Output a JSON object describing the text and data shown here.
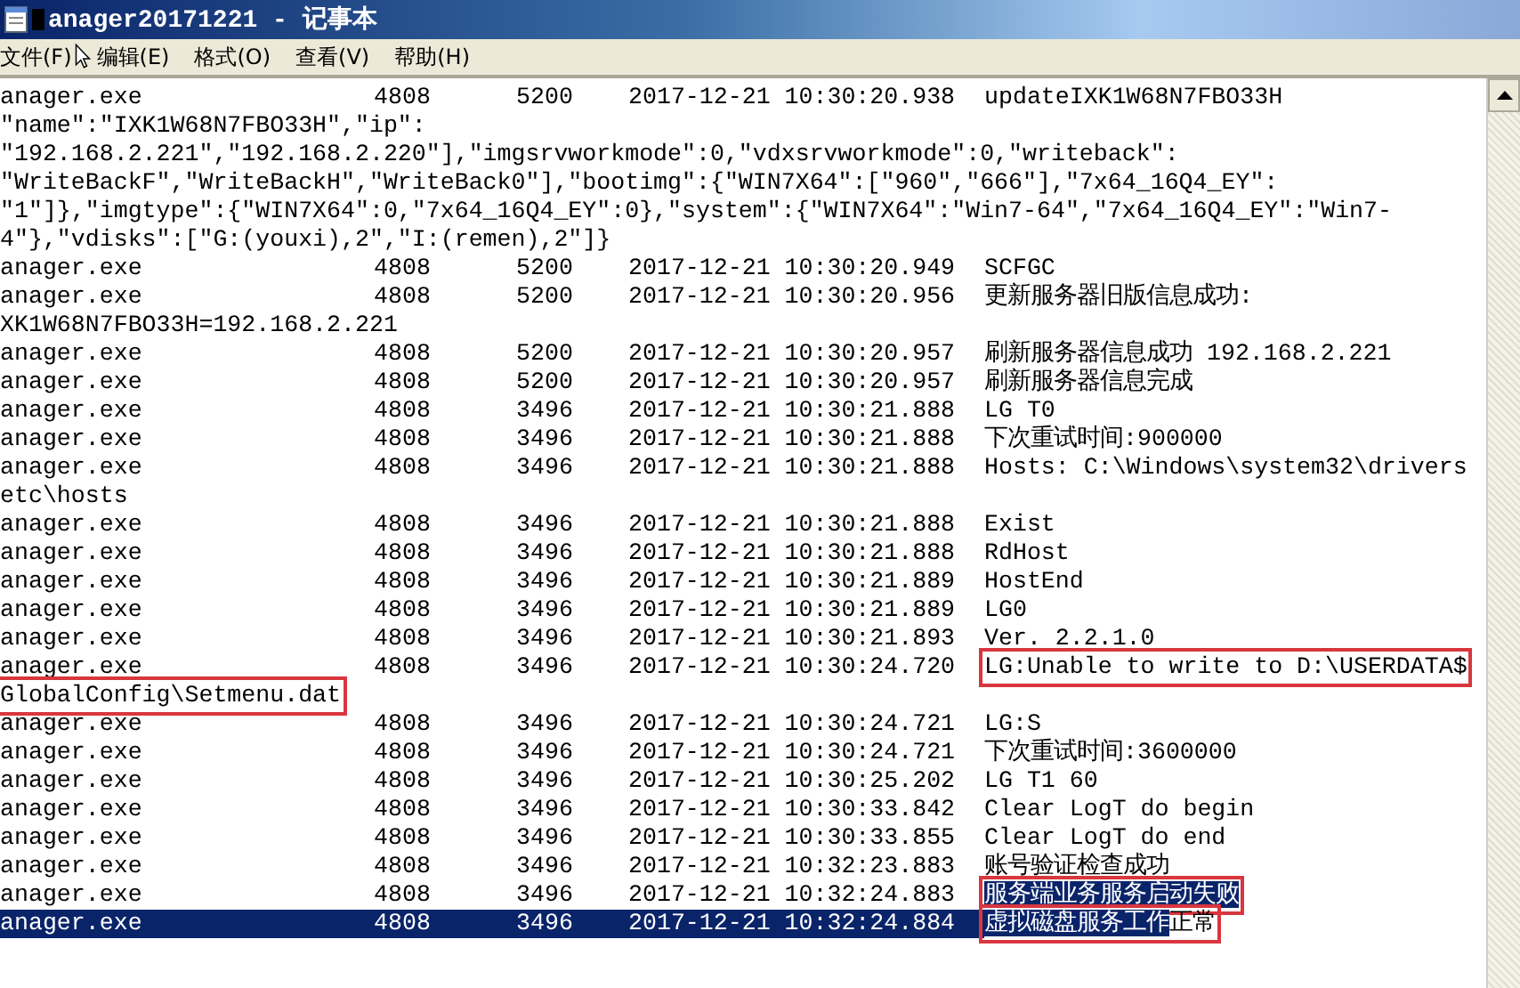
{
  "window": {
    "title": "anager20171221 - 记事本"
  },
  "menu": [
    {
      "label": "文件(F)"
    },
    {
      "label": "编辑(E)"
    },
    {
      "label": "格式(O)"
    },
    {
      "label": "查看(V)"
    },
    {
      "label": "帮助(H)"
    }
  ],
  "lines": [
    {
      "kind": "row",
      "selected": false,
      "cells": [
        "anager.exe",
        "4808",
        "5200",
        "2017-12-21 10:30:20.938"
      ],
      "message": [
        {
          "text": "updateIXK1W68N7FBO33H",
          "selected": false
        }
      ]
    },
    {
      "kind": "wrap",
      "text": "\"name\":\"IXK1W68N7FBO33H\",\"ip\":"
    },
    {
      "kind": "wrap",
      "text": "\"192.168.2.221\",\"192.168.2.220\"],\"imgsrvworkmode\":0,\"vdxsrvworkmode\":0,\"writeback\":"
    },
    {
      "kind": "wrap",
      "text": "\"WriteBackF\",\"WriteBackH\",\"WriteBack0\"],\"bootimg\":{\"WIN7X64\":[\"960\",\"666\"],\"7x64_16Q4_EY\":"
    },
    {
      "kind": "wrap",
      "text": "\"1\"]},\"imgtype\":{\"WIN7X64\":0,\"7x64_16Q4_EY\":0},\"system\":{\"WIN7X64\":\"Win7-64\",\"7x64_16Q4_EY\":\"Win7-"
    },
    {
      "kind": "wrap",
      "text": "4\"},\"vdisks\":[\"G:(youxi),2\",\"I:(remen),2\"]}"
    },
    {
      "kind": "row",
      "selected": false,
      "cells": [
        "anager.exe",
        "4808",
        "5200",
        "2017-12-21 10:30:20.949"
      ],
      "message": [
        {
          "text": "SCFGC",
          "selected": false
        }
      ]
    },
    {
      "kind": "row",
      "selected": false,
      "cells": [
        "anager.exe",
        "4808",
        "5200",
        "2017-12-21 10:30:20.956"
      ],
      "message": [
        {
          "text": "更新服务器旧版信息成功:",
          "selected": false
        }
      ]
    },
    {
      "kind": "wrap",
      "text": "XK1W68N7FBO33H=192.168.2.221"
    },
    {
      "kind": "row",
      "selected": false,
      "cells": [
        "anager.exe",
        "4808",
        "5200",
        "2017-12-21 10:30:20.957"
      ],
      "message": [
        {
          "text": "刷新服务器信息成功 192.168.2.221",
          "selected": false
        }
      ]
    },
    {
      "kind": "row",
      "selected": false,
      "cells": [
        "anager.exe",
        "4808",
        "5200",
        "2017-12-21 10:30:20.957"
      ],
      "message": [
        {
          "text": "刷新服务器信息完成",
          "selected": false
        }
      ]
    },
    {
      "kind": "row",
      "selected": false,
      "cells": [
        "anager.exe",
        "4808",
        "3496",
        "2017-12-21 10:30:21.888"
      ],
      "message": [
        {
          "text": "LG T0",
          "selected": false
        }
      ]
    },
    {
      "kind": "row",
      "selected": false,
      "cells": [
        "anager.exe",
        "4808",
        "3496",
        "2017-12-21 10:30:21.888"
      ],
      "message": [
        {
          "text": "下次重试时间:900000",
          "selected": false
        }
      ]
    },
    {
      "kind": "row",
      "selected": false,
      "cells": [
        "anager.exe",
        "4808",
        "3496",
        "2017-12-21 10:30:21.888"
      ],
      "message": [
        {
          "text": "Hosts: C:\\Windows\\system32\\drivers",
          "selected": false
        }
      ]
    },
    {
      "kind": "wrap",
      "text": "etc\\hosts"
    },
    {
      "kind": "row",
      "selected": false,
      "cells": [
        "anager.exe",
        "4808",
        "3496",
        "2017-12-21 10:30:21.888"
      ],
      "message": [
        {
          "text": "Exist",
          "selected": false
        }
      ]
    },
    {
      "kind": "row",
      "selected": false,
      "cells": [
        "anager.exe",
        "4808",
        "3496",
        "2017-12-21 10:30:21.888"
      ],
      "message": [
        {
          "text": "RdHost",
          "selected": false
        }
      ]
    },
    {
      "kind": "row",
      "selected": false,
      "cells": [
        "anager.exe",
        "4808",
        "3496",
        "2017-12-21 10:30:21.889"
      ],
      "message": [
        {
          "text": "HostEnd",
          "selected": false
        }
      ]
    },
    {
      "kind": "row",
      "selected": false,
      "cells": [
        "anager.exe",
        "4808",
        "3496",
        "2017-12-21 10:30:21.889"
      ],
      "message": [
        {
          "text": "LG0",
          "selected": false
        }
      ]
    },
    {
      "kind": "row",
      "selected": false,
      "cells": [
        "anager.exe",
        "4808",
        "3496",
        "2017-12-21 10:30:21.893"
      ],
      "message": [
        {
          "text": "Ver. 2.2.1.0",
          "selected": false
        }
      ]
    },
    {
      "kind": "row",
      "selected": false,
      "cells": [
        "anager.exe",
        "4808",
        "3496",
        "2017-12-21 10:30:24.720"
      ],
      "message": [
        {
          "text": "LG:Unable to write to D:\\USERDATA$",
          "selected": false
        }
      ],
      "marked": true
    },
    {
      "kind": "wrap",
      "text": "GlobalConfig\\Setmenu.dat",
      "marked": true
    },
    {
      "kind": "row",
      "selected": false,
      "cells": [
        "anager.exe",
        "4808",
        "3496",
        "2017-12-21 10:30:24.721"
      ],
      "message": [
        {
          "text": "LG:S",
          "selected": false
        }
      ]
    },
    {
      "kind": "row",
      "selected": false,
      "cells": [
        "anager.exe",
        "4808",
        "3496",
        "2017-12-21 10:30:24.721"
      ],
      "message": [
        {
          "text": "下次重试时间:3600000",
          "selected": false
        }
      ]
    },
    {
      "kind": "row",
      "selected": false,
      "cells": [
        "anager.exe",
        "4808",
        "3496",
        "2017-12-21 10:30:25.202"
      ],
      "message": [
        {
          "text": "LG T1 60",
          "selected": false
        }
      ]
    },
    {
      "kind": "row",
      "selected": false,
      "cells": [
        "anager.exe",
        "4808",
        "3496",
        "2017-12-21 10:30:33.842"
      ],
      "message": [
        {
          "text": "Clear LogT do begin",
          "selected": false
        }
      ]
    },
    {
      "kind": "row",
      "selected": false,
      "cells": [
        "anager.exe",
        "4808",
        "3496",
        "2017-12-21 10:30:33.855"
      ],
      "message": [
        {
          "text": "Clear LogT do end",
          "selected": false
        }
      ]
    },
    {
      "kind": "row",
      "selected": false,
      "cells": [
        "anager.exe",
        "4808",
        "3496",
        "2017-12-21 10:32:23.883"
      ],
      "message": [
        {
          "text": "账号验证检查成功",
          "selected": false
        }
      ]
    },
    {
      "kind": "row",
      "selected": false,
      "cells": [
        "anager.exe",
        "4808",
        "3496",
        "2017-12-21 10:32:24.883"
      ],
      "message": [
        {
          "text": "服务端业务服务启动失败",
          "selected": true
        }
      ],
      "marked": true
    },
    {
      "kind": "row",
      "selected": true,
      "cells": [
        "anager.exe",
        "4808",
        "3496",
        "2017-12-21 10:32:24.884"
      ],
      "message": [
        {
          "text": "虚拟磁盘服务工作",
          "selected": true
        },
        {
          "text": "正常",
          "selected": false
        }
      ],
      "marked": true
    }
  ]
}
